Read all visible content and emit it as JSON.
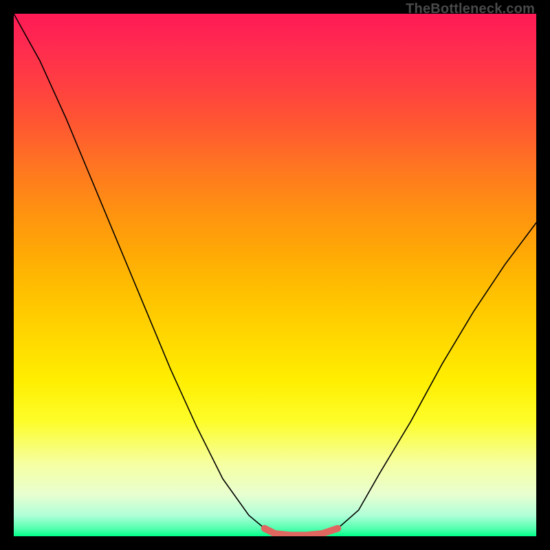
{
  "watermark": "TheBottleneck.com",
  "chart_data": {
    "type": "line",
    "title": "",
    "xlabel": "",
    "ylabel": "",
    "xlim": [
      0,
      1
    ],
    "ylim": [
      0,
      1
    ],
    "grid": false,
    "legend": false,
    "background_gradient": {
      "top_color": "#ff1a55",
      "mid_color": "#ffe000",
      "bottom_color": "#00ff88"
    },
    "series": [
      {
        "name": "bottleneck-curve",
        "x": [
          0.0,
          0.05,
          0.1,
          0.15,
          0.2,
          0.25,
          0.3,
          0.35,
          0.4,
          0.45,
          0.48,
          0.5,
          0.53,
          0.56,
          0.59,
          0.62,
          0.66,
          0.7,
          0.76,
          0.82,
          0.88,
          0.94,
          1.0
        ],
        "y": [
          1.0,
          0.91,
          0.8,
          0.68,
          0.56,
          0.44,
          0.32,
          0.21,
          0.11,
          0.04,
          0.015,
          0.005,
          0.002,
          0.002,
          0.005,
          0.015,
          0.05,
          0.12,
          0.22,
          0.33,
          0.43,
          0.52,
          0.6
        ],
        "color": "#000000"
      }
    ],
    "highlight": {
      "name": "optimal-range",
      "x": [
        0.48,
        0.5,
        0.53,
        0.56,
        0.59,
        0.62
      ],
      "y": [
        0.015,
        0.005,
        0.002,
        0.002,
        0.005,
        0.015
      ],
      "color": "#e06660"
    }
  }
}
